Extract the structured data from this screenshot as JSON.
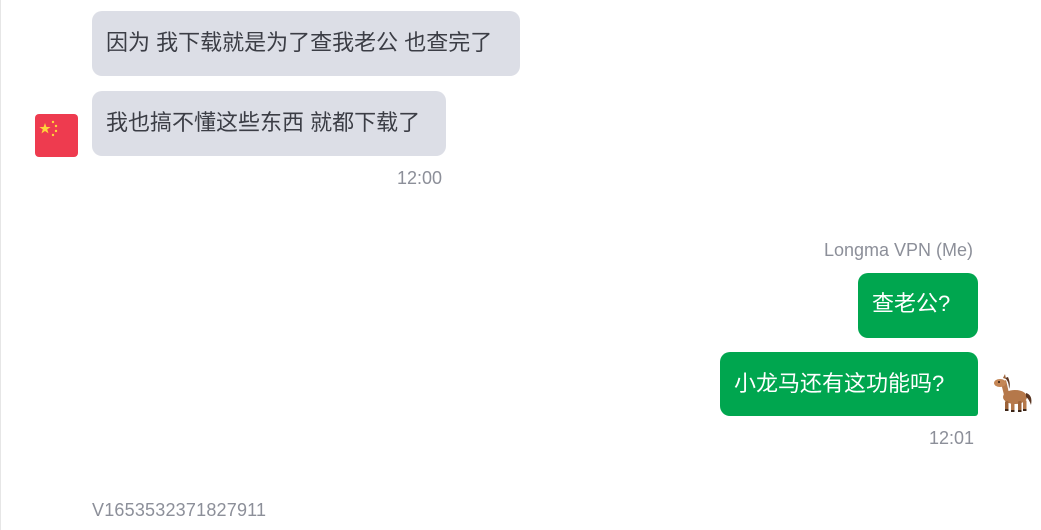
{
  "incoming": {
    "messages": [
      "因为 我下载就是为了查我老公 也查完了",
      "我也搞不懂这些东西 就都下载了"
    ],
    "time": "12:00"
  },
  "outgoing": {
    "sender": "Longma VPN (Me)",
    "messages": [
      "查老公?",
      "小龙马还有这功能吗?"
    ],
    "time": "12:01"
  },
  "footer": {
    "id": "V1653532371827911"
  },
  "colors": {
    "incoming_bubble": "#dcdee6",
    "outgoing_bubble": "#00a64f",
    "meta_text": "#8c8f99"
  },
  "icons": {
    "incoming_avatar": "china-flag-icon",
    "outgoing_avatar": "pony-icon"
  }
}
